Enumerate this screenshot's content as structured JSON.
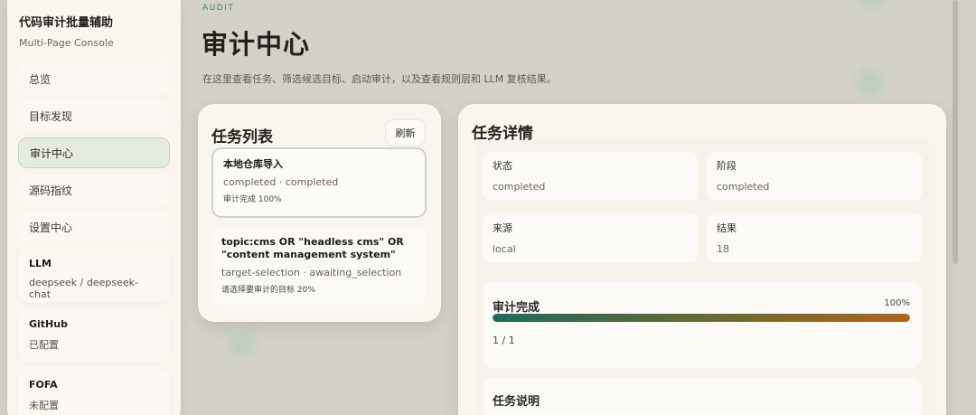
{
  "sidebar": {
    "brand_title": "代码审计批量辅助",
    "brand_subtitle": "Multi-Page Console",
    "nav": [
      {
        "label": "总览"
      },
      {
        "label": "目标发现"
      },
      {
        "label": "审计中心"
      },
      {
        "label": "源码指纹"
      },
      {
        "label": "设置中心"
      }
    ],
    "active_index": 2,
    "cards": [
      {
        "title": "LLM",
        "value": "deepseek / deepseek-chat"
      },
      {
        "title": "GitHub",
        "value": "已配置"
      },
      {
        "title": "FOFA",
        "value": "未配置"
      }
    ]
  },
  "header": {
    "eyebrow": "AUDIT",
    "title": "审计中心",
    "description": "在这里查看任务、筛选候选目标、启动审计，以及查看规则层和 LLM 复核结果。"
  },
  "task_list": {
    "title": "任务列表",
    "refresh_label": "刷新",
    "tasks": [
      {
        "name": "本地仓库导入",
        "meta": "completed · completed",
        "status": "审计完成 100%"
      },
      {
        "name": "topic:cms OR \"headless cms\" OR \"content management system\"",
        "meta": "target-selection · awaiting_selection",
        "status": "请选择要审计的目标 20%"
      }
    ]
  },
  "detail": {
    "title": "任务详情",
    "stats": [
      {
        "label": "状态",
        "value": "completed"
      },
      {
        "label": "阶段",
        "value": "completed"
      },
      {
        "label": "来源",
        "value": "local"
      },
      {
        "label": "结果",
        "value": "18"
      }
    ],
    "progress": {
      "label": "审计完成",
      "percent_text": "100%",
      "fraction": 1.0,
      "count": "1 / 1"
    },
    "description_title": "任务说明"
  },
  "colors": {
    "accent": "#1e6b5b",
    "progress_end": "#b2641c",
    "active_nav_bg": "#e6ebe2"
  }
}
